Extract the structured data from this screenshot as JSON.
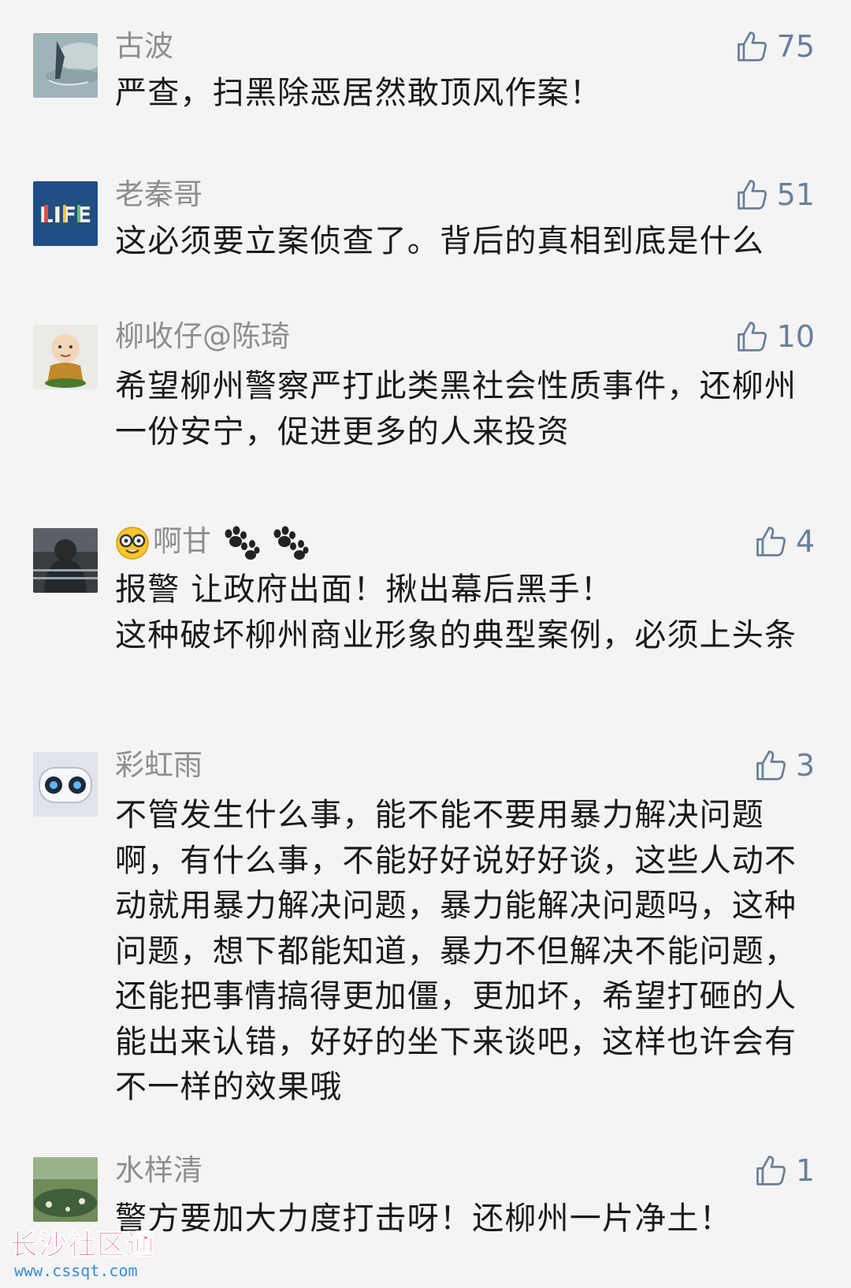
{
  "comments": [
    {
      "name": "古波",
      "text": "严查，扫黑除恶居然敢顶风作案！",
      "likes": "75",
      "avatar": "water-photo"
    },
    {
      "name": "老秦哥",
      "text": "这必须要立案侦查了。背后的真相到底是什么",
      "likes": "51",
      "avatar": "life-logo"
    },
    {
      "name": "柳收仔@陈琦",
      "text": "希望柳州警察严打此类黑社会性质事件，还柳州一份安宁，促进更多的人来投资",
      "likes": "10",
      "avatar": "monk-figurine"
    },
    {
      "name": "啊甘",
      "text": "报警 让政府出面！揪出幕后黑手！\n这种破坏柳州商业形象的典型案例，必须上头条",
      "likes": "4",
      "avatar": "gorilla-ring"
    },
    {
      "name": "彩虹雨",
      "text": "不管发生什么事，能不能不要用暴力解决问题啊，有什么事，不能好好说好好谈，这些人动不动就用暴力解决问题，暴力能解决问题吗，这种问题，想下都能知道，暴力不但解决不能问题，还能把事情搞得更加僵，更加坏，希望打砸的人能出来认错，好好的坐下来谈吧，这样也许会有不一样的效果哦",
      "likes": "3",
      "avatar": "robot-face"
    },
    {
      "name": "水样清",
      "text": "警方要加大力度打击呀！还柳州一片净土！",
      "likes": "1",
      "avatar": "pond-photo"
    }
  ],
  "icons": {
    "like": "thumbs-up-icon"
  },
  "colors": {
    "name": "#8e8e8e",
    "like": "#6b7f99",
    "text": "#1a1a1a",
    "background": "#f4f4f4"
  },
  "watermark": {
    "title": "长沙社区通",
    "url": "www.cssqt.com"
  }
}
